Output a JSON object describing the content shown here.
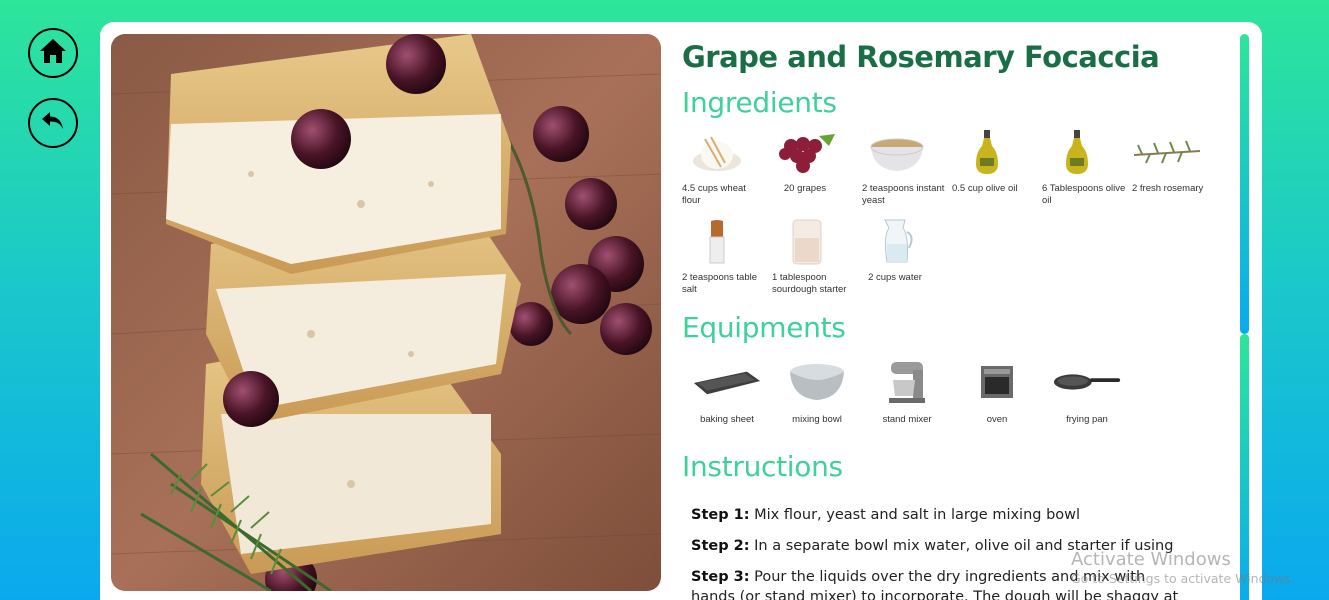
{
  "nav": {
    "home_icon": "home-icon",
    "back_icon": "back-arrow-icon"
  },
  "recipe": {
    "title": "Grape and Rosemary Focaccia"
  },
  "ingredients": {
    "heading": "Ingredients",
    "items": [
      {
        "label": "4.5 cups wheat flour",
        "icon": "flour-icon"
      },
      {
        "label": "20 grapes",
        "icon": "grapes-icon"
      },
      {
        "label": "2 teaspoons instant yeast",
        "icon": "yeast-icon"
      },
      {
        "label": "0.5 cup olive oil",
        "icon": "olive-oil-icon"
      },
      {
        "label": "6 Tablespoons olive oil",
        "icon": "olive-oil-icon"
      },
      {
        "label": "2 fresh rosemary",
        "icon": "rosemary-icon"
      },
      {
        "label": "2 teaspoons table salt",
        "icon": "salt-icon"
      },
      {
        "label": "1 tablespoon sourdough starter",
        "icon": "sourdough-starter-icon"
      },
      {
        "label": "2 cups water",
        "icon": "water-jug-icon"
      }
    ]
  },
  "equipments": {
    "heading": "Equipments",
    "items": [
      {
        "label": "baking sheet",
        "icon": "baking-sheet-icon"
      },
      {
        "label": "mixing bowl",
        "icon": "mixing-bowl-icon"
      },
      {
        "label": "stand mixer",
        "icon": "stand-mixer-icon"
      },
      {
        "label": "oven",
        "icon": "oven-icon"
      },
      {
        "label": "frying pan",
        "icon": "frying-pan-icon"
      }
    ]
  },
  "instructions": {
    "heading": "Instructions",
    "steps": [
      {
        "label": "Step 1:",
        "text": " Mix flour, yeast and salt in large mixing bowl"
      },
      {
        "label": "Step 2:",
        "text": " In a separate bowl mix water, olive oil and starter if using"
      },
      {
        "label": "Step 3:",
        "text": " Pour the liquids over the dry ingredients and mix with hands (or stand mixer) to incorporate. The dough will be shaggy at first, but"
      }
    ]
  },
  "watermark": {
    "line1": "Activate Windows",
    "line2": "Go to Settings to activate Windows."
  },
  "colors": {
    "title": "#1a6e46",
    "section": "#3ed19a",
    "bg_top": "#2ee59a",
    "bg_bottom": "#0aa9ee"
  }
}
